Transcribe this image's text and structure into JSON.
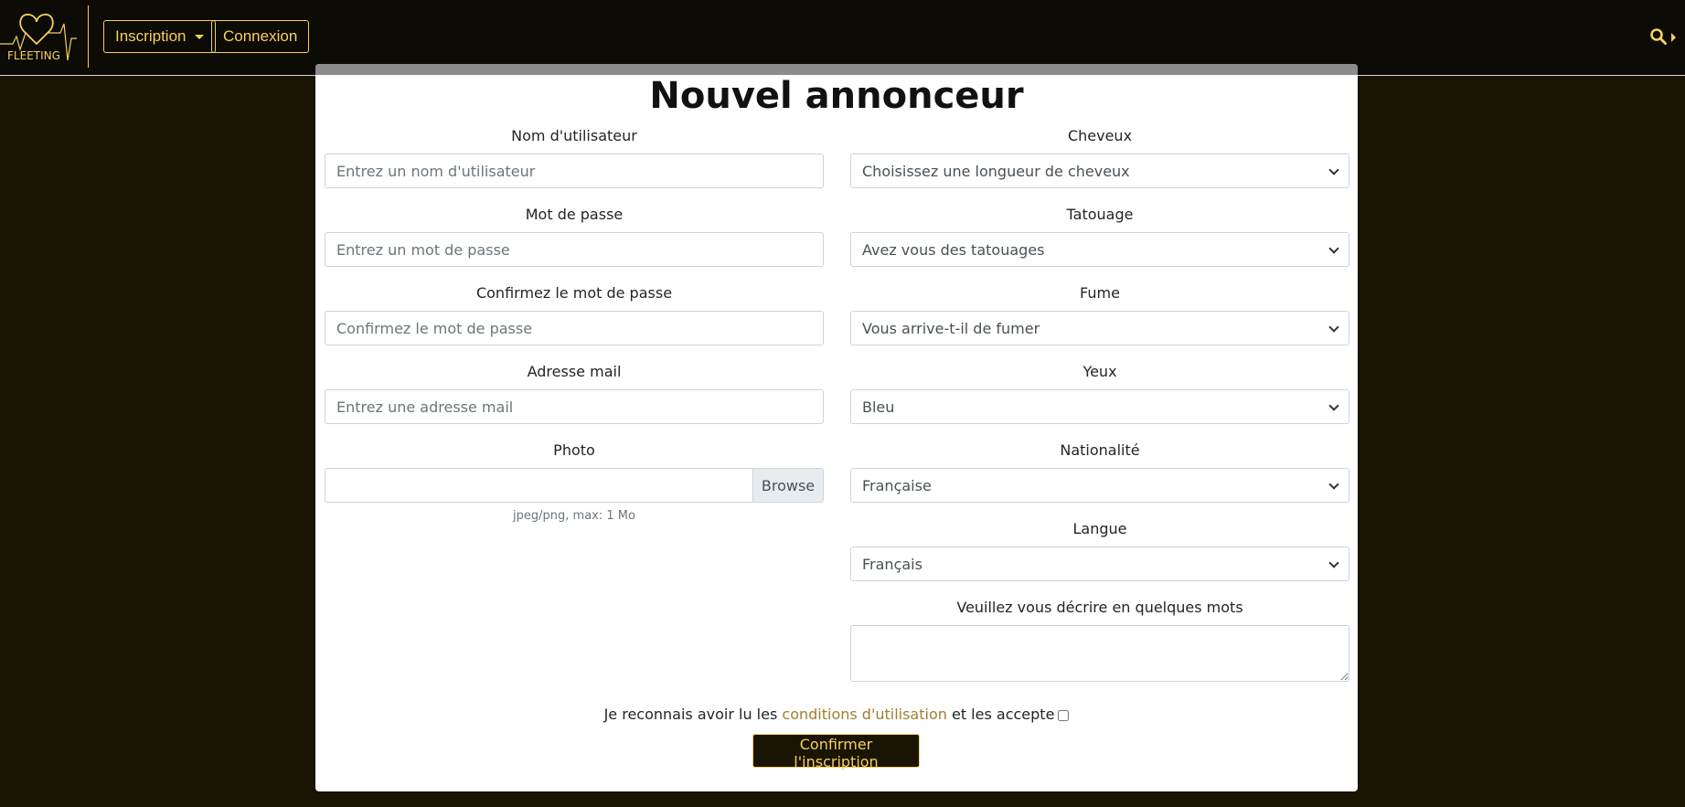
{
  "nav": {
    "logo_text": "FLEETING",
    "inscription_label": "Inscription",
    "connexion_label": "Connexion"
  },
  "colors": {
    "accent": "#f5d060",
    "background": "#1a1405",
    "navbar": "#0d0b05"
  },
  "icons": {
    "search": "magnifier-icon",
    "dropdown": "caret-icon"
  },
  "form": {
    "title": "Nouvel annonceur",
    "left": {
      "username_label": "Nom d'utilisateur",
      "username_placeholder": "Entrez un nom d'utilisateur",
      "password_label": "Mot de passe",
      "password_placeholder": "Entrez un mot de passe",
      "confirm_label": "Confirmez le mot de passe",
      "confirm_placeholder": "Confirmez le mot de passe",
      "email_label": "Adresse mail",
      "email_placeholder": "Entrez une adresse mail",
      "photo_label": "Photo",
      "browse_label": "Browse",
      "photo_help": "jpeg/png, max: 1 Mo"
    },
    "right": {
      "hair_label": "Cheveux",
      "hair_value": "Choisissez une longueur de cheveux",
      "tattoo_label": "Tatouage",
      "tattoo_value": "Avez vous des tatouages",
      "smoke_label": "Fume",
      "smoke_value": "Vous arrive-t-il de fumer",
      "eyes_label": "Yeux",
      "eyes_value": "Bleu",
      "nationality_label": "Nationalité",
      "nationality_value": "Française",
      "language_label": "Langue",
      "language_value": "Français",
      "description_label": "Veuillez vous décrire en quelques mots"
    },
    "terms": {
      "prefix": "Je reconnais avoir lu les ",
      "link": "conditions d'utilisation",
      "suffix": " et les accepte"
    },
    "submit_label": "Confirmer l'inscription"
  }
}
